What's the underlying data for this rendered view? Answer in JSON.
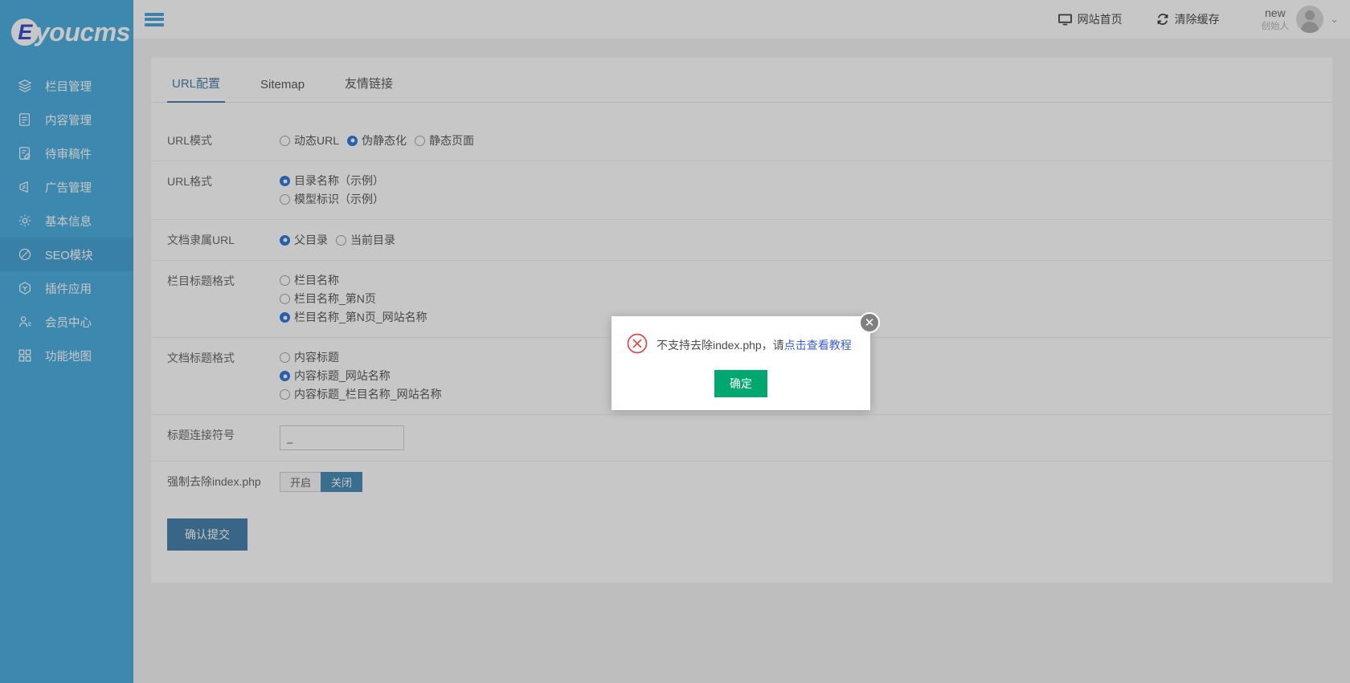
{
  "brand": {
    "logo_badge": "E",
    "logo_text": "youcms"
  },
  "sidebar": {
    "items": [
      {
        "label": "栏目管理",
        "icon": "layers-icon",
        "active": false
      },
      {
        "label": "内容管理",
        "icon": "document-icon",
        "active": false
      },
      {
        "label": "待审稿件",
        "icon": "document-edit-icon",
        "active": false
      },
      {
        "label": "广告管理",
        "icon": "megaphone-icon",
        "active": false
      },
      {
        "label": "基本信息",
        "icon": "gear-icon",
        "active": false
      },
      {
        "label": "SEO模块",
        "icon": "ban-icon",
        "active": true
      },
      {
        "label": "插件应用",
        "icon": "box-icon",
        "active": false
      },
      {
        "label": "会员中心",
        "icon": "user-icon",
        "active": false
      },
      {
        "label": "功能地图",
        "icon": "grid-icon",
        "active": false
      }
    ]
  },
  "topbar": {
    "menu_toggle": "hamburger-icon",
    "site_home": "网站首页",
    "clear_cache": "清除缓存",
    "user_name": "new",
    "user_role": "创始人",
    "caret": "⌄"
  },
  "tabs": [
    {
      "label": "URL配置",
      "active": true
    },
    {
      "label": "Sitemap",
      "active": false
    },
    {
      "label": "友情链接",
      "active": false
    }
  ],
  "form": {
    "rows": [
      {
        "label": "URL模式",
        "type": "radio-inline",
        "options": [
          {
            "label": "动态URL",
            "selected": false
          },
          {
            "label": "伪静态化",
            "selected": true
          },
          {
            "label": "静态页面",
            "selected": false
          }
        ]
      },
      {
        "label": "URL格式",
        "type": "radio-block",
        "options": [
          {
            "label": "目录名称（示例）",
            "selected": true
          },
          {
            "label": "模型标识（示例）",
            "selected": false
          }
        ]
      },
      {
        "label": "文档隶属URL",
        "type": "radio-inline",
        "options": [
          {
            "label": "父目录",
            "selected": true
          },
          {
            "label": "当前目录",
            "selected": false
          }
        ]
      },
      {
        "label": "栏目标题格式",
        "type": "radio-block",
        "options": [
          {
            "label": "栏目名称",
            "selected": false
          },
          {
            "label": "栏目名称_第N页",
            "selected": false
          },
          {
            "label": "栏目名称_第N页_网站名称",
            "selected": true
          }
        ]
      },
      {
        "label": "文档标题格式",
        "type": "radio-block",
        "options": [
          {
            "label": "内容标题",
            "selected": false
          },
          {
            "label": "内容标题_网站名称",
            "selected": true
          },
          {
            "label": "内容标题_栏目名称_网站名称",
            "selected": false
          }
        ]
      },
      {
        "label": "标题连接符号",
        "type": "input",
        "value": "_",
        "placeholder": ""
      },
      {
        "label": "强制去除index.php",
        "type": "switch",
        "on_label": "开启",
        "off_label": "关闭",
        "state": "off"
      }
    ],
    "submit_label": "确认提交"
  },
  "modal": {
    "icon": "error-circle-x-icon",
    "message_prefix": "不支持去除index.php，请",
    "message_link": "点击查看教程",
    "ok_label": "确定",
    "close_label": "✕"
  },
  "colors": {
    "sidebar": "#34a3db",
    "sidebar_active": "#2e97cf",
    "accent": "#2f6f9f",
    "radio_on": "#1266d8",
    "ok_green": "#00a870",
    "error_red": "#e04a4a",
    "link_blue": "#3b5fd4"
  }
}
